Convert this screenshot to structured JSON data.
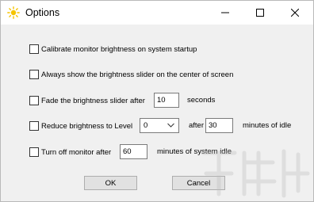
{
  "window": {
    "title": "Options"
  },
  "options": {
    "calibrate_label": "Calibrate monitor brightness on system startup",
    "center_slider_label": "Always show the brightness slider on the center of screen",
    "fade": {
      "label": "Fade the brightness slider after",
      "value": "10",
      "suffix": "seconds"
    },
    "reduce": {
      "label": "Reduce brightness to Level",
      "level_value": "0",
      "after_label": "after",
      "minutes_value": "30",
      "suffix": "minutes of idle"
    },
    "turnoff": {
      "label": "Turn off monitor after",
      "value": "60",
      "suffix": "minutes of system idle"
    }
  },
  "buttons": {
    "ok": "OK",
    "cancel": "Cancel"
  },
  "colors": {
    "icon_yellow": "#f5c400",
    "titlebar_bg": "#ffffff",
    "dialog_bg": "#f0f0f0"
  },
  "icons": [
    "sun-icon",
    "minimize-icon",
    "maximize-icon",
    "close-icon",
    "chevron-down-icon"
  ]
}
